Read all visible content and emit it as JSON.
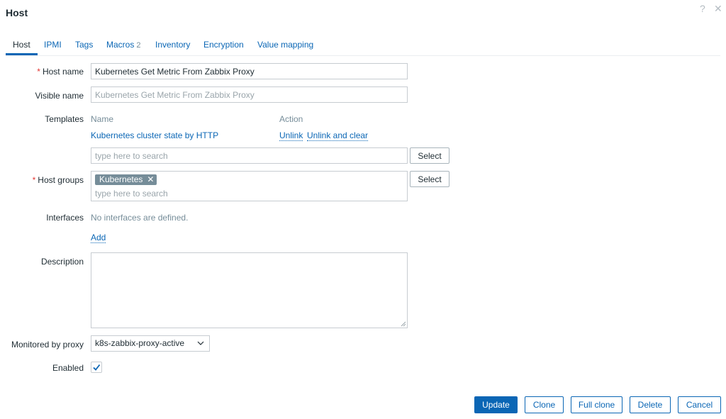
{
  "dialog": {
    "title": "Host",
    "help_glyph": "?",
    "close_glyph": "✕"
  },
  "tabs": [
    {
      "label": "Host"
    },
    {
      "label": "IPMI"
    },
    {
      "label": "Tags"
    },
    {
      "label": "Macros",
      "badge": "2"
    },
    {
      "label": "Inventory"
    },
    {
      "label": "Encryption"
    },
    {
      "label": "Value mapping"
    }
  ],
  "form": {
    "required_mark": "*",
    "host_name": {
      "label": "Host name",
      "value": "Kubernetes Get Metric From Zabbix Proxy"
    },
    "visible_name": {
      "label": "Visible name",
      "placeholder": "Kubernetes Get Metric From Zabbix Proxy"
    },
    "templates": {
      "label": "Templates",
      "col_name": "Name",
      "col_action": "Action",
      "items": [
        {
          "name": "Kubernetes cluster state by HTTP",
          "unlink": "Unlink",
          "unlink_clear": "Unlink and clear"
        }
      ],
      "search_placeholder": "type here to search",
      "select_label": "Select"
    },
    "host_groups": {
      "label": "Host groups",
      "chips": [
        "Kubernetes"
      ],
      "chip_remove": "✕",
      "search_placeholder": "type here to search",
      "select_label": "Select"
    },
    "interfaces": {
      "label": "Interfaces",
      "empty_text": "No interfaces are defined.",
      "add_label": "Add"
    },
    "description": {
      "label": "Description",
      "value": ""
    },
    "monitored_by_proxy": {
      "label": "Monitored by proxy",
      "value": "k8s-zabbix-proxy-active"
    },
    "enabled": {
      "label": "Enabled",
      "checked": true
    }
  },
  "footer": {
    "update": "Update",
    "clone": "Clone",
    "full_clone": "Full clone",
    "delete": "Delete",
    "cancel": "Cancel"
  },
  "colors": {
    "accent": "#0a66b5",
    "required": "#e33734",
    "chip_bg": "#768d99"
  }
}
